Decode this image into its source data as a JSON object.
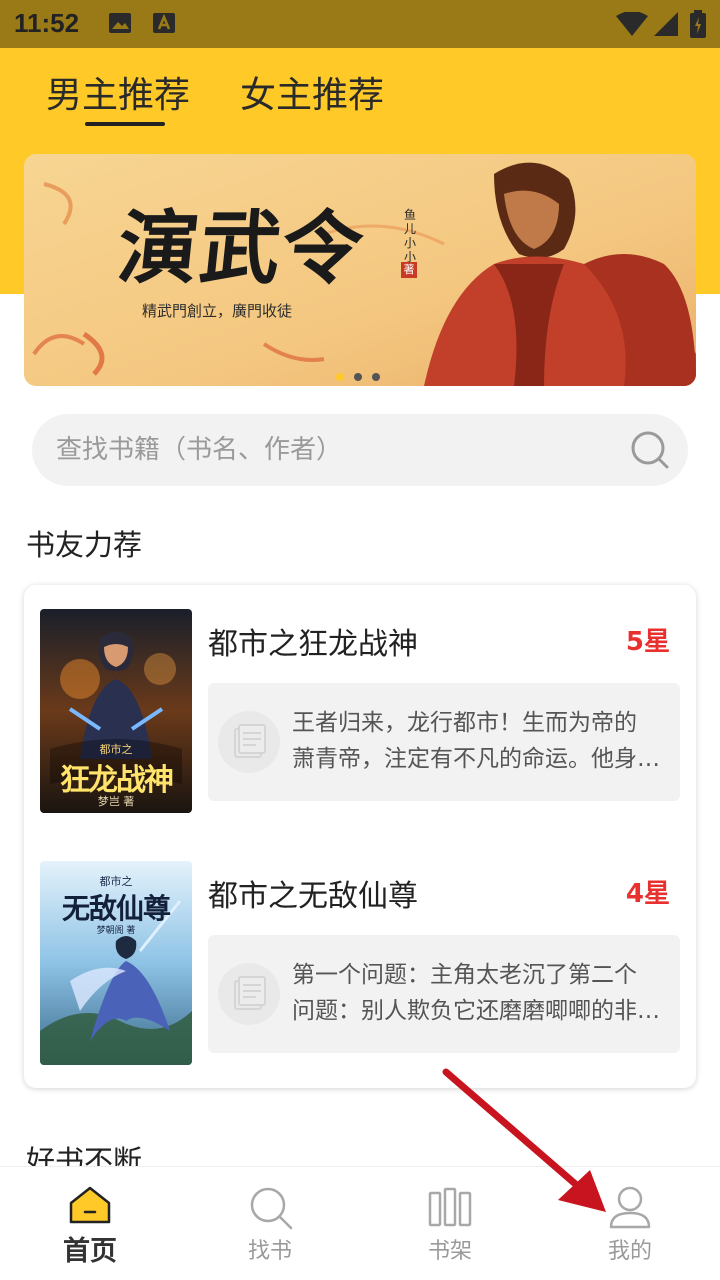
{
  "status_bar": {
    "time": "11:52"
  },
  "tabs": [
    {
      "label": "男主推荐",
      "active": true
    },
    {
      "label": "女主推荐",
      "active": false
    }
  ],
  "banner": {
    "title": "演武令",
    "author": "鱼儿小小",
    "seal": "著",
    "subtitle": "精武門創立，廣門收徒",
    "slide_count": 3,
    "active_slide": 1
  },
  "search": {
    "placeholder": "查找书籍（书名、作者）",
    "value": ""
  },
  "section_recommend": {
    "title": "书友力荐"
  },
  "books": [
    {
      "title": "都市之狂龙战神",
      "rating": "5星",
      "desc_line1": "王者归来，龙行都市！生而为帝的",
      "desc_line2": "萧青帝，注定有不凡的命运。他身…",
      "cover_title": "狂龙战神",
      "cover_series": "都市之",
      "cover_author": "梦岂   著"
    },
    {
      "title": "都市之无敌仙尊",
      "rating": "4星",
      "desc_line1": "第一个问题：主角太老沉了第二个",
      "desc_line2": "问题：别人欺负它还磨磨唧唧的非…",
      "cover_title": "无敌仙尊",
      "cover_series": "都市之",
      "cover_author": "梦朝阁 著"
    }
  ],
  "section_more": {
    "title": "好书不断"
  },
  "bottom_nav": [
    {
      "label": "首页",
      "icon": "home-icon",
      "active": true
    },
    {
      "label": "找书",
      "icon": "search-icon",
      "active": false
    },
    {
      "label": "书架",
      "icon": "bookshelf-icon",
      "active": false
    },
    {
      "label": "我的",
      "icon": "profile-icon",
      "active": false
    }
  ],
  "colors": {
    "accent": "#ffc928",
    "rating": "#e8312f",
    "status_bar": "#9a7a17",
    "annotation_arrow": "#c8141e"
  }
}
